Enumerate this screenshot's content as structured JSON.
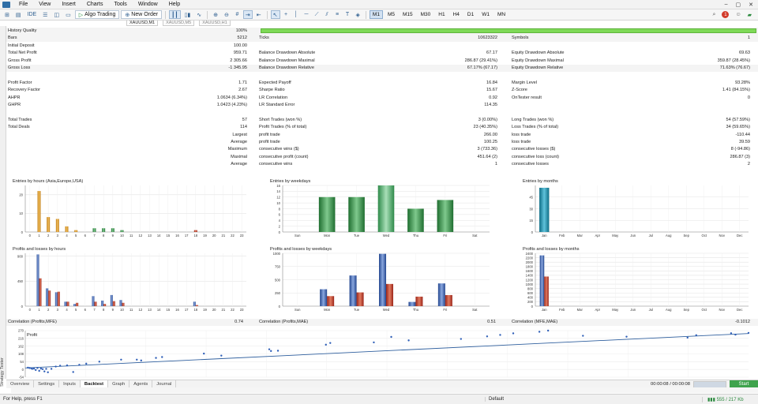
{
  "menu": [
    "File",
    "View",
    "Insert",
    "Charts",
    "Tools",
    "Window",
    "Help"
  ],
  "window_controls": [
    "–",
    "▢",
    "✕"
  ],
  "toolbar": {
    "algo_trading": "Algo Trading",
    "new_order": "New Order",
    "timeframes": [
      "M1",
      "M5",
      "M15",
      "M30",
      "H1",
      "H4",
      "D1",
      "W1",
      "MN"
    ],
    "active_timeframe": "M1",
    "notifications": "1"
  },
  "chart_tabs": [
    "XAUUSD,M1",
    "XAUUSD,M5",
    "XAUUSD,H1"
  ],
  "stats": {
    "rows": [
      {
        "c1": [
          "History Quality",
          "100%"
        ],
        "c2": null,
        "c3": null,
        "shade": true,
        "hq": true
      },
      {
        "c1": [
          "Bars",
          "5212"
        ],
        "c2": [
          "Ticks",
          "10623322"
        ],
        "c3": [
          "Symbols",
          "1"
        ],
        "shade": true
      },
      {
        "c1": [
          "Initial Deposit",
          "100.00"
        ],
        "c2": null,
        "c3": null
      },
      {
        "c1": [
          "Total Net Profit",
          "959.71"
        ],
        "c2": [
          "Balance Drawdown Absolute",
          "67.17"
        ],
        "c3": [
          "Equity Drawdown Absolute",
          "69.63"
        ]
      },
      {
        "c1": [
          "Gross Profit",
          "2 305.66"
        ],
        "c2": [
          "Balance Drawdown Maximal",
          "286.87 (29.41%)"
        ],
        "c3": [
          "Equity Drawdown Maximal",
          "359.87 (28.45%)"
        ]
      },
      {
        "c1": [
          "Gross Loss",
          "-1 345.95"
        ],
        "c2": [
          "Balance Drawdown Relative",
          "67.17% (67.17)"
        ],
        "c3": [
          "Equity Drawdown Relative",
          "71.63% (76.67)"
        ],
        "shade": true
      },
      {
        "c1": null,
        "c2": null,
        "c3": null
      },
      {
        "c1": [
          "Profit Factor",
          "1.71"
        ],
        "c2": [
          "Expected Payoff",
          "16.84"
        ],
        "c3": [
          "Margin Level",
          "93.28%"
        ]
      },
      {
        "c1": [
          "Recovery Factor",
          "2.67"
        ],
        "c2": [
          "Sharpe Ratio",
          "15.67"
        ],
        "c3": [
          "Z-Score",
          "1.41 (84.15%)"
        ]
      },
      {
        "c1": [
          "AHPR",
          "1.0634 (6.34%)"
        ],
        "c2": [
          "LR Correlation",
          "0.92"
        ],
        "c3": [
          "OnTester result",
          "0"
        ]
      },
      {
        "c1": [
          "GHPR",
          "1.0423 (4.23%)"
        ],
        "c2": [
          "LR Standard Error",
          "114.35"
        ],
        "c3": null
      },
      {
        "c1": null,
        "c2": null,
        "c3": null
      },
      {
        "c1": [
          "Total Trades",
          "57"
        ],
        "c2": [
          "Short Trades (won %)",
          "3 (0.00%)"
        ],
        "c3": [
          "Long Trades (won %)",
          "54 (57.59%)"
        ]
      },
      {
        "c1": [
          "Total Deals",
          "114"
        ],
        "c2": [
          "Profit Trades (% of total)",
          "23 (40.35%)"
        ],
        "c3": [
          "Loss Trades (% of total)",
          "34 (59.65%)"
        ]
      },
      {
        "c1": [
          "Largest",
          ""
        ],
        "c2": [
          "profit trade",
          "266.00"
        ],
        "c3": [
          "loss trade",
          "-110.44"
        ],
        "right": true
      },
      {
        "c1": [
          "Average",
          ""
        ],
        "c2": [
          "profit trade",
          "100.25"
        ],
        "c3": [
          "loss trade",
          "39.59"
        ],
        "right": true
      },
      {
        "c1": [
          "Maximum",
          ""
        ],
        "c2": [
          "consecutive wins ($)",
          "3 (733.36)"
        ],
        "c3": [
          "consecutive losses ($)",
          "8 (-94.86)"
        ],
        "right": true
      },
      {
        "c1": [
          "Maximal",
          ""
        ],
        "c2": [
          "consecutive profit (count)",
          "451.64 (2)"
        ],
        "c3": [
          "consecutive loss (count)",
          "286.87 (3)"
        ],
        "right": true
      },
      {
        "c1": [
          "Average",
          ""
        ],
        "c2": [
          "consecutive wins",
          "1"
        ],
        "c3": [
          "consecutive losses",
          "2"
        ],
        "right": true
      }
    ]
  },
  "correlations": [
    {
      "label": "Correlation (Profits,MFE)",
      "value": "0.74"
    },
    {
      "label": "Correlation (Profits,MAE)",
      "value": "0.51"
    },
    {
      "label": "Correlation (MFE,MAE)",
      "value": "-0.1012"
    }
  ],
  "chart_data": [
    {
      "type": "bar",
      "title": "Entries by hours (Asia,Europe,USA)",
      "categories": [
        "0",
        "1",
        "2",
        "3",
        "4",
        "5",
        "6",
        "7",
        "8",
        "9",
        "10",
        "11",
        "12",
        "13",
        "14",
        "15",
        "16",
        "17",
        "18",
        "19",
        "20",
        "21",
        "22",
        "23"
      ],
      "ytick_labels": [
        "0",
        "10",
        "20"
      ],
      "ylim": [
        0,
        25
      ],
      "values": [
        0,
        22,
        8,
        7,
        3,
        1,
        0,
        2,
        2,
        2,
        1,
        0,
        0,
        0,
        0,
        0,
        0,
        0,
        1,
        0,
        0,
        0,
        0,
        0
      ],
      "colors_by_index": {
        "1": "#d89a2a",
        "2": "#d89a2a",
        "3": "#d89a2a",
        "4": "#d89a2a",
        "5": "#d89a2a",
        "7": "#2e7d3a",
        "8": "#2e7d3a",
        "9": "#2e7d3a",
        "10": "#2e7d3a",
        "18": "#c0392b"
      }
    },
    {
      "type": "bar",
      "title": "Entries by weekdays",
      "categories": [
        "Sun",
        "Mon",
        "Tue",
        "Wed",
        "Thu",
        "Fri",
        "Sat"
      ],
      "ytick_labels": [
        "0",
        "2",
        "4",
        "6",
        "8",
        "10",
        "12",
        "14",
        "16"
      ],
      "ylim": [
        0,
        16
      ],
      "values": [
        0,
        12,
        12,
        16,
        8,
        11,
        0
      ]
    },
    {
      "type": "bar",
      "title": "Entries by months",
      "categories": [
        "Jan",
        "Feb",
        "Mar",
        "Apr",
        "May",
        "Jun",
        "Jul",
        "Aug",
        "Sep",
        "Oct",
        "Nov",
        "Dec"
      ],
      "ytick_labels": [
        "0",
        "15",
        "30",
        "45"
      ],
      "ylim": [
        0,
        60
      ],
      "values": [
        57,
        0,
        0,
        0,
        0,
        0,
        0,
        0,
        0,
        0,
        0,
        0
      ]
    },
    {
      "type": "bar",
      "title": "Profits and losses by hours",
      "categories": [
        "0",
        "1",
        "2",
        "3",
        "4",
        "5",
        "6",
        "7",
        "8",
        "9",
        "10",
        "11",
        "12",
        "13",
        "14",
        "15",
        "16",
        "17",
        "18",
        "19",
        "20",
        "21",
        "22",
        "23"
      ],
      "ytick_labels": [
        "0",
        "450",
        "900"
      ],
      "ylim": [
        0,
        950
      ],
      "series": [
        {
          "name": "Profit",
          "values": [
            0,
            930,
            320,
            250,
            80,
            40,
            0,
            180,
            100,
            200,
            110,
            0,
            0,
            0,
            0,
            0,
            0,
            0,
            80,
            0,
            0,
            0,
            0,
            0
          ]
        },
        {
          "name": "Loss",
          "values": [
            0,
            500,
            280,
            260,
            80,
            60,
            0,
            80,
            40,
            90,
            60,
            0,
            0,
            0,
            0,
            0,
            0,
            0,
            20,
            0,
            0,
            0,
            0,
            0
          ]
        }
      ]
    },
    {
      "type": "bar",
      "title": "Profits and losses by weekdays",
      "categories": [
        "Sun",
        "Mon",
        "Tue",
        "Wed",
        "Thu",
        "Fri",
        "Sat"
      ],
      "ytick_labels": [
        "0",
        "250",
        "500",
        "750",
        "1000"
      ],
      "ylim": [
        0,
        1000
      ],
      "series": [
        {
          "name": "Profit",
          "values": [
            0,
            320,
            580,
            990,
            80,
            430,
            0
          ]
        },
        {
          "name": "Loss",
          "values": [
            0,
            190,
            260,
            420,
            180,
            210,
            0
          ]
        }
      ]
    },
    {
      "type": "bar",
      "title": "Profits and losses by months",
      "categories": [
        "Jan",
        "Feb",
        "Mar",
        "Apr",
        "May",
        "Jun",
        "Jul",
        "Aug",
        "Sep",
        "Oct",
        "Nov",
        "Dec"
      ],
      "ytick_labels": [
        "0",
        "200",
        "400",
        "600",
        "800",
        "1000",
        "1200",
        "1400",
        "1600",
        "1800",
        "2000",
        "2200",
        "2400"
      ],
      "ylim": [
        0,
        2400
      ],
      "series": [
        {
          "name": "Profit",
          "values": [
            2305,
            0,
            0,
            0,
            0,
            0,
            0,
            0,
            0,
            0,
            0,
            0
          ]
        },
        {
          "name": "Loss",
          "values": [
            1345,
            0,
            0,
            0,
            0,
            0,
            0,
            0,
            0,
            0,
            0,
            0
          ]
        }
      ]
    },
    {
      "type": "scatter",
      "title": "Profit",
      "ytick_labels": [
        "270",
        "216",
        "162",
        "108",
        "54",
        "0",
        "-54"
      ],
      "ylim": [
        -54,
        270
      ],
      "xlim": [
        0,
        300
      ],
      "x": [
        3,
        5,
        7,
        8,
        10,
        12,
        14,
        16,
        18,
        20,
        22,
        24,
        26,
        30,
        35,
        40,
        48,
        55,
        62,
        70,
        85,
        110,
        128,
        133,
        150,
        157,
        205,
        225,
        280,
        282,
        290,
        345,
        350,
        400,
        420,
        440,
        500,
        530,
        545,
        560,
        590,
        600,
        640,
        690,
        760,
        770,
        810,
        815,
        830
      ],
      "y": [
        12,
        10,
        8,
        4,
        6,
        -4,
        10,
        -10,
        6,
        2,
        -14,
        4,
        -20,
        4,
        20,
        26,
        28,
        -18,
        32,
        40,
        54,
        68,
        68,
        62,
        80,
        86,
        110,
        96,
        140,
        128,
        130,
        172,
        184,
        188,
        226,
        202,
        212,
        230,
        240,
        251,
        262,
        270,
        234,
        228,
        221,
        238,
        252,
        242,
        254
      ],
      "trend": [
        [
          0,
          10
        ],
        [
          830,
          250
        ]
      ]
    }
  ],
  "bottom_tabs": [
    "Overview",
    "Settings",
    "Inputs",
    "Backtest",
    "Graph",
    "Agents",
    "Journal"
  ],
  "active_bottom_tab": "Backtest",
  "progress": {
    "time": "00:00:08 / 00:00:08",
    "value": 1.0
  },
  "start_label": "Start",
  "status": {
    "help": "For Help, press F1",
    "profile": "Default",
    "network": "555 / 217 Kb"
  },
  "strategy_tester_label": "Strategy Tester"
}
